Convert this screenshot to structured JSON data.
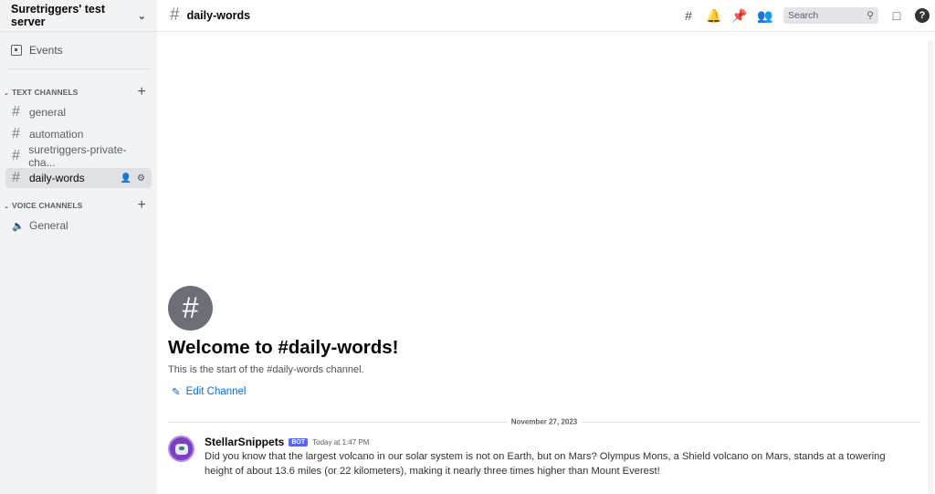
{
  "server": {
    "name": "Suretriggers' test server"
  },
  "sidebar": {
    "events_label": "Events",
    "text_category": "TEXT CHANNELS",
    "voice_category": "VOICE CHANNELS",
    "text_channels": [
      {
        "name": "general"
      },
      {
        "name": "automation"
      },
      {
        "name": "suretriggers-private-cha..."
      },
      {
        "name": "daily-words"
      }
    ],
    "voice_channels": [
      {
        "name": "General"
      }
    ]
  },
  "header": {
    "channel": "daily-words",
    "search_placeholder": "Search"
  },
  "welcome": {
    "title": "Welcome to #daily-words!",
    "subtitle": "This is the start of the #daily-words channel.",
    "edit_label": "Edit Channel"
  },
  "date_divider": "November 27, 2023",
  "message": {
    "author": "StellarSnippets",
    "badge": "BOT",
    "time": "Today at 1:47 PM",
    "text": "Did you know that the largest volcano in our solar system is not on Earth, but on Mars? Olympus Mons, a Shield volcano on Mars, stands at a towering height of about 13.6 miles (or 22 kilometers), making it nearly three times higher than Mount Everest!"
  }
}
